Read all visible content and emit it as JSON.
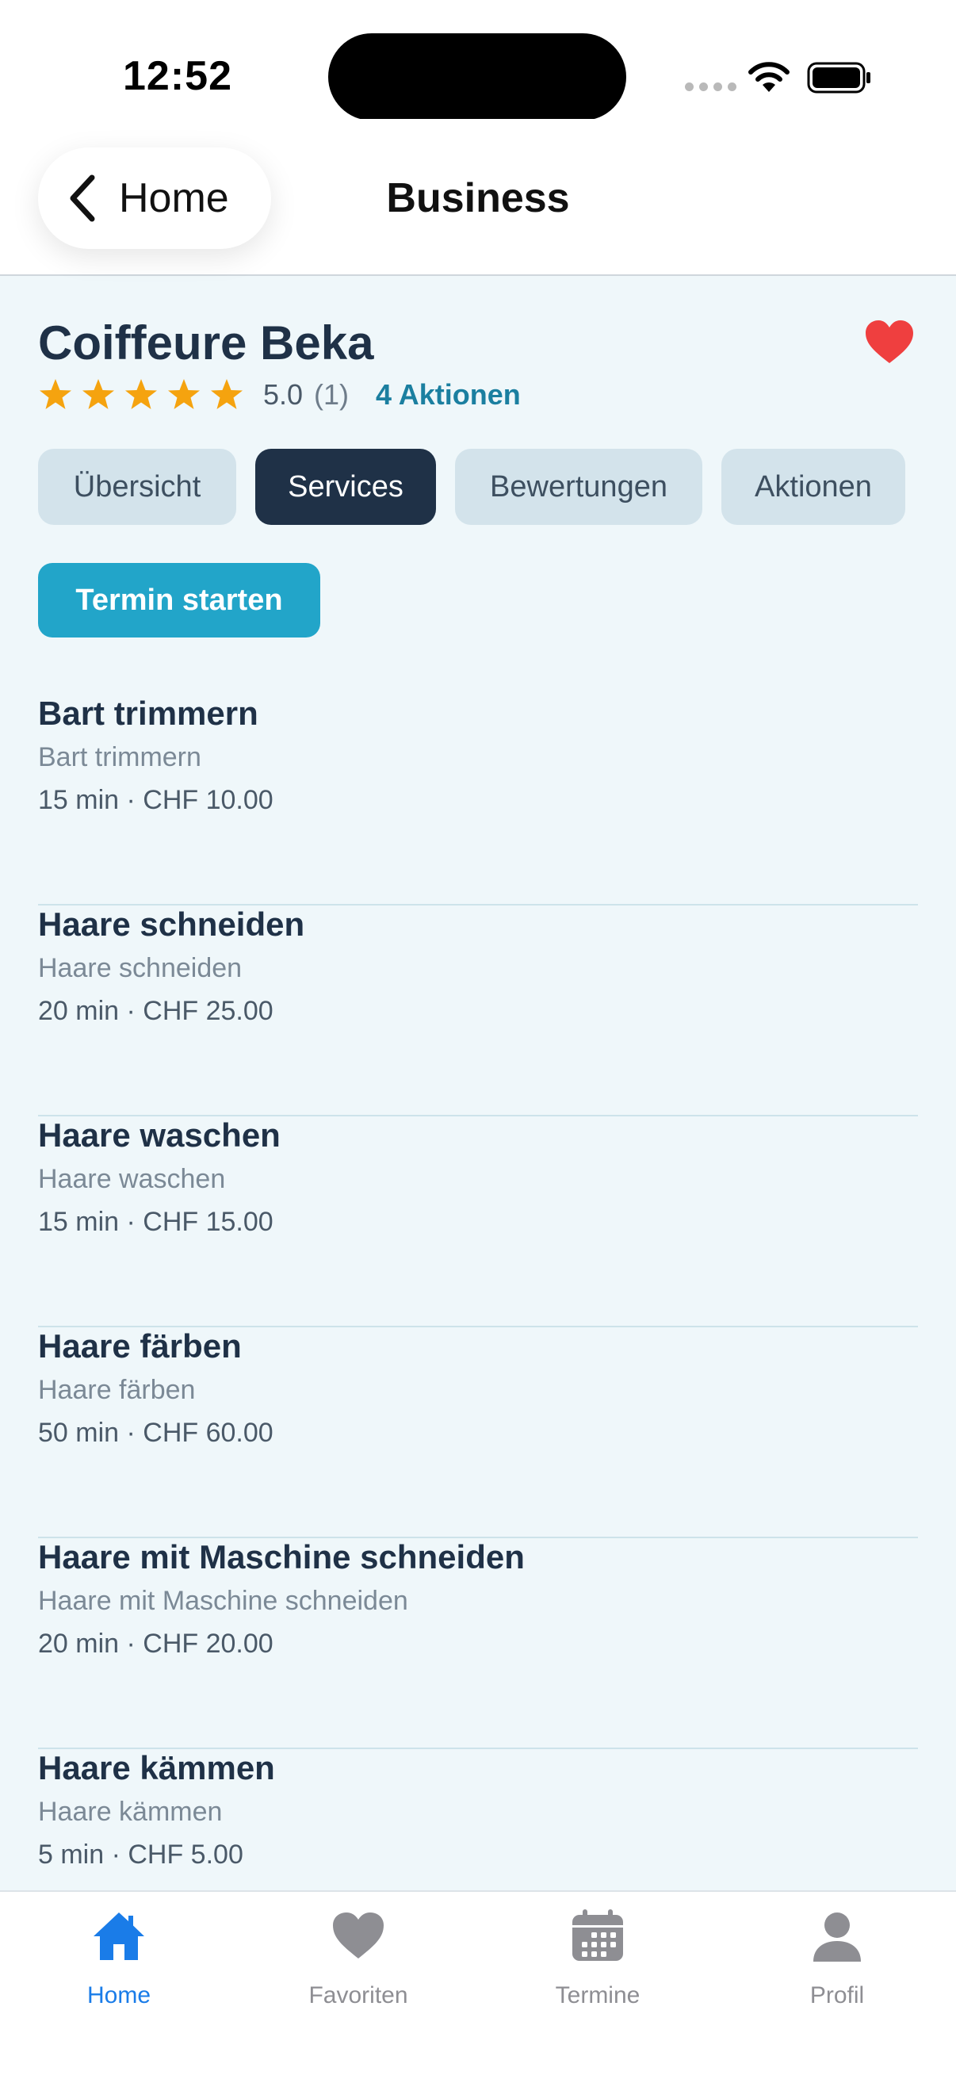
{
  "status": {
    "time": "12:52"
  },
  "nav": {
    "back_label": "Home",
    "title": "Business"
  },
  "business": {
    "name": "Coiffeure Beka",
    "rating": "5.0",
    "review_count": "(1)",
    "stars": 5,
    "promotions_link": "4 Aktionen",
    "favorited": true
  },
  "tabs": [
    {
      "label": "Übersicht",
      "active": false
    },
    {
      "label": "Services",
      "active": true
    },
    {
      "label": "Bewertungen",
      "active": false
    },
    {
      "label": "Aktionen",
      "active": false
    }
  ],
  "cta": {
    "label": "Termin starten"
  },
  "services": [
    {
      "name": "Bart trimmern",
      "description": "Bart trimmern",
      "meta": "15 min · CHF 10.00"
    },
    {
      "name": "Haare schneiden",
      "description": "Haare schneiden",
      "meta": "20 min · CHF 25.00"
    },
    {
      "name": "Haare waschen",
      "description": "Haare waschen",
      "meta": "15 min · CHF 15.00"
    },
    {
      "name": "Haare färben",
      "description": "Haare färben",
      "meta": "50 min · CHF 60.00"
    },
    {
      "name": "Haare mit Maschine schneiden",
      "description": "Haare mit Maschine schneiden",
      "meta": "20 min · CHF 20.00"
    },
    {
      "name": "Haare kämmen",
      "description": "Haare kämmen",
      "meta": "5 min · CHF 5.00"
    }
  ],
  "tab_bar": [
    {
      "label": "Home",
      "icon": "house-icon",
      "active": true
    },
    {
      "label": "Favoriten",
      "icon": "heart-icon",
      "active": false
    },
    {
      "label": "Termine",
      "icon": "calendar-icon",
      "active": false
    },
    {
      "label": "Profil",
      "icon": "person-icon",
      "active": false
    }
  ],
  "colors": {
    "accent": "#22a5c9",
    "active_tab": "#1f3147",
    "star": "#f5a30f",
    "heart": "#ef3f3f",
    "tab_bar_active": "#1a7ce8"
  }
}
